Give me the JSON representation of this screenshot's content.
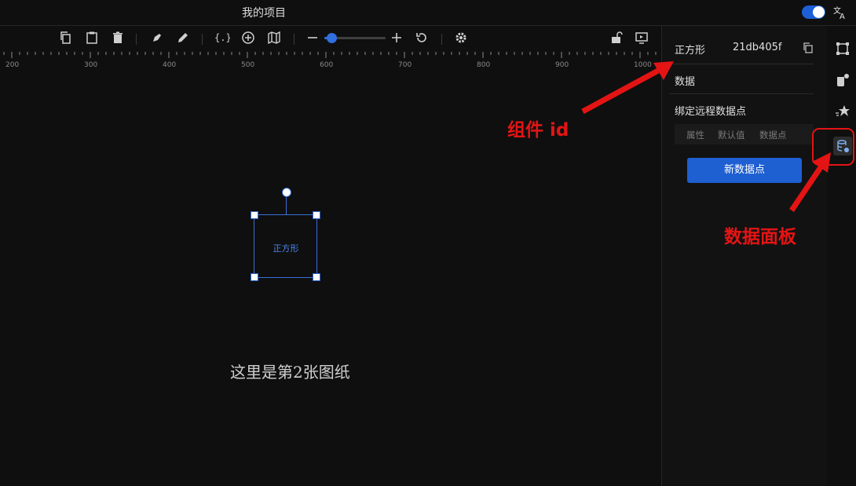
{
  "header": {
    "title": "我的项目"
  },
  "toolbar": {
    "zoom_percent": 10
  },
  "ruler": {
    "labels": [
      "200",
      "300",
      "400",
      "500",
      "600",
      "700",
      "800",
      "900",
      "1000"
    ]
  },
  "canvas": {
    "shape_label": "正方形",
    "page_note": "这里是第2张图纸"
  },
  "panel": {
    "component_type": "正方形",
    "component_id": "21db405f",
    "section_title": "数据",
    "bind_label": "绑定远程数据点",
    "table_headers": [
      "属性",
      "默认值",
      "数据点"
    ],
    "new_button": "新数据点"
  },
  "annotations": {
    "component_id_label": "组件 id",
    "data_panel_label": "数据面板"
  },
  "colors": {
    "accent": "#1e5fd1",
    "annotation": "#e41414",
    "background": "#0f0f0f"
  }
}
